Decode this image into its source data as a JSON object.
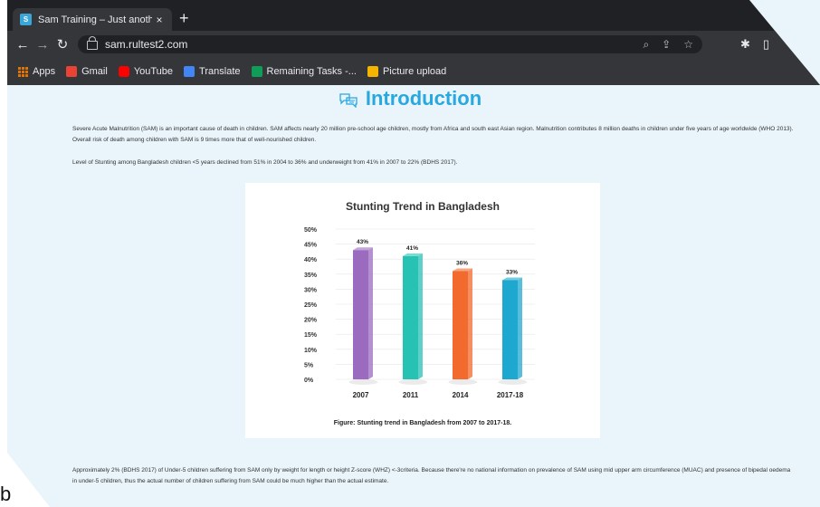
{
  "browser": {
    "tab_title": "Sam Training – Just another W",
    "tab_close": "×",
    "new_tab": "+",
    "url": "sam.rultest2.com",
    "bookmarks": [
      {
        "label": "Apps",
        "icon": "apps-grid-icon",
        "color": "#e37400"
      },
      {
        "label": "Gmail",
        "icon": "gmail-icon",
        "color": "#ea4335"
      },
      {
        "label": "YouTube",
        "icon": "youtube-icon",
        "color": "#ff0000"
      },
      {
        "label": "Translate",
        "icon": "translate-icon",
        "color": "#4285f4"
      },
      {
        "label": "Remaining Tasks -...",
        "icon": "sheets-icon",
        "color": "#0f9d58"
      },
      {
        "label": "Picture upload",
        "icon": "slides-icon",
        "color": "#f4b400"
      }
    ]
  },
  "page": {
    "heading": "Introduction",
    "heading_color": "#29a8e0",
    "para1": "Severe Acute Malnutrition (SAM) is an important cause of death in children. SAM affects nearly 20 million pre-school age children, mostly from Africa and south east Asian region. Malnutrition contributes 8 million deaths in children under five years of age worldwide (WHO 2013). Overall risk of death among children with SAM is 9 times more that of well-nourished children.",
    "para2": "Level of Stunting among Bangladesh children <5 years declined from 51% in 2004 to 36% and underweight from 41% in 2007 to 22% (BDHS 2017).",
    "caption": "Figure: Stunting trend in Bangladesh from 2007 to 2017-18.",
    "para3": "Approximately 2% (BDHS 2017) of Under-5 children suffering from SAM only by weight for length or height Z-score (WHZ) <-3criteria. Because there're no national information on prevalence of SAM using mid upper arm circumference (MUAC) and presence of bipedal oedema in under-5 children, thus the actual number of children suffering from SAM could be much higher than the actual estimate.",
    "stray_letter": "b"
  },
  "chart_data": {
    "type": "bar",
    "title": "Stunting Trend in Bangladesh",
    "categories": [
      "2007",
      "2011",
      "2014",
      "2017-18"
    ],
    "values": [
      43,
      41,
      36,
      33
    ],
    "data_labels": [
      "43%",
      "41%",
      "36%",
      "33%"
    ],
    "colors": [
      "#9b6bbf",
      "#27c2b4",
      "#f26a2e",
      "#1fa8cf"
    ],
    "yticks": [
      "0%",
      "5%",
      "10%",
      "15%",
      "20%",
      "25%",
      "30%",
      "35%",
      "40%",
      "45%",
      "50%"
    ],
    "ylim": [
      0,
      50
    ],
    "grid": true
  }
}
